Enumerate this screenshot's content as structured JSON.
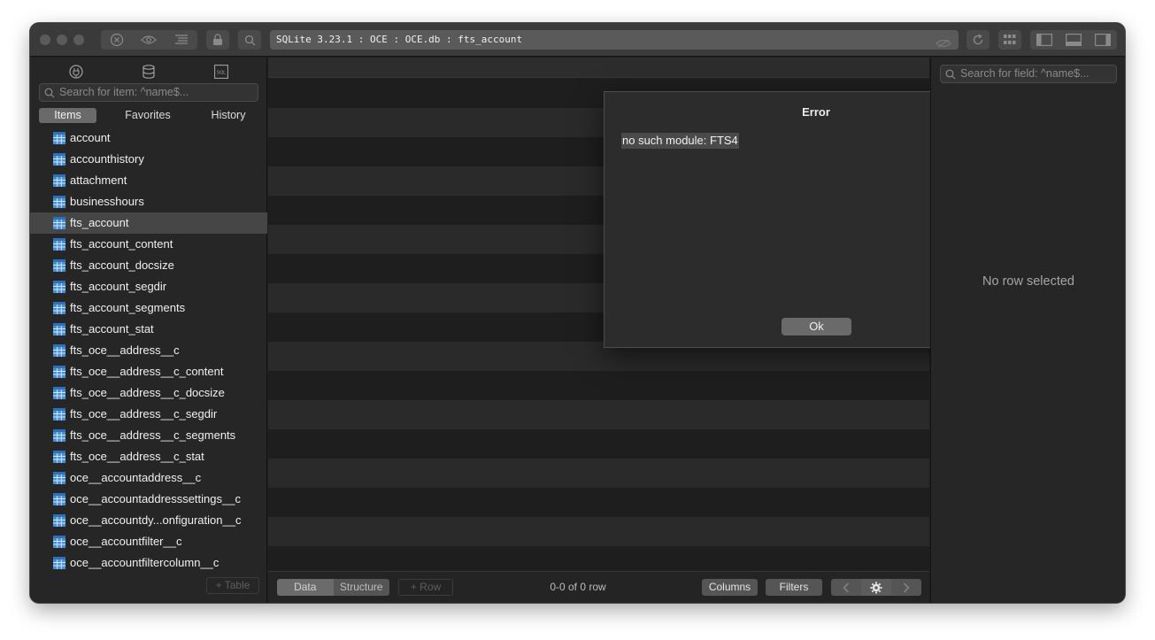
{
  "toolbar": {
    "path": "SQLite 3.23.1 : OCE : OCE.db : fts_account",
    "icons": [
      "close-circle-icon",
      "eye-icon",
      "list-icon",
      "lock-icon",
      "search-icon",
      "refresh-icon",
      "grid-icon",
      "left-pane-icon",
      "bottom-pane-icon",
      "right-pane-icon"
    ]
  },
  "sidebar": {
    "search_placeholder": "Search for item: ^name$...",
    "tabs": [
      {
        "label": "Items",
        "active": true
      },
      {
        "label": "Favorites",
        "active": false
      },
      {
        "label": "History",
        "active": false
      }
    ],
    "items": [
      {
        "label": "account"
      },
      {
        "label": "accounthistory"
      },
      {
        "label": "attachment"
      },
      {
        "label": "businesshours"
      },
      {
        "label": "fts_account",
        "selected": true
      },
      {
        "label": "fts_account_content"
      },
      {
        "label": "fts_account_docsize"
      },
      {
        "label": "fts_account_segdir"
      },
      {
        "label": "fts_account_segments"
      },
      {
        "label": "fts_account_stat"
      },
      {
        "label": "fts_oce__address__c"
      },
      {
        "label": "fts_oce__address__c_content"
      },
      {
        "label": "fts_oce__address__c_docsize"
      },
      {
        "label": "fts_oce__address__c_segdir"
      },
      {
        "label": "fts_oce__address__c_segments"
      },
      {
        "label": "fts_oce__address__c_stat"
      },
      {
        "label": "oce__accountaddress__c"
      },
      {
        "label": "oce__accountaddresssettings__c"
      },
      {
        "label": "oce__accountdy...onfiguration__c"
      },
      {
        "label": "oce__accountfilter__c"
      },
      {
        "label": "oce__accountfiltercolumn__c"
      }
    ],
    "add_table_label": "+ Table"
  },
  "bottom_bar": {
    "data_label": "Data",
    "structure_label": "Structure",
    "add_row_label": "+ Row",
    "row_count": "0-0 of 0 row",
    "columns_label": "Columns",
    "filters_label": "Filters"
  },
  "right_panel": {
    "search_placeholder": "Search for field: ^name$...",
    "empty_text": "No row selected"
  },
  "dialog": {
    "title": "Error",
    "message": "no such module: FTS4",
    "ok_label": "Ok"
  },
  "colors": {
    "window_bg": "#1f1f1f",
    "toolbar_bg": "#3a3a3a",
    "table_icon": "#4a90d9",
    "selection_bg": "#464646"
  }
}
